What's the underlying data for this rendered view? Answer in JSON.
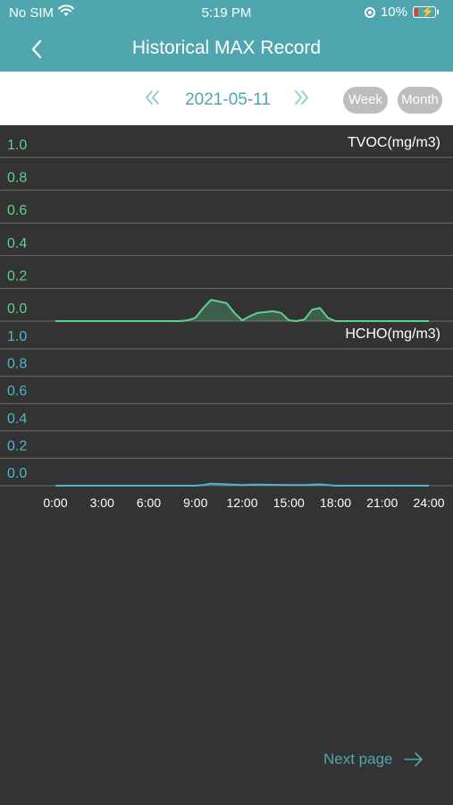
{
  "status_bar": {
    "carrier": "No SIM",
    "time": "5:19 PM",
    "battery": "10%"
  },
  "header": {
    "title": "Historical MAX Record"
  },
  "date_bar": {
    "date": "2021-05-11",
    "week_label": "Week",
    "month_label": "Month"
  },
  "colors": {
    "teal": "#4fa6ae",
    "tvoc_green": "#5fd08f",
    "hcho_blue": "#4ab7c8",
    "background": "#333333"
  },
  "chart_data": [
    {
      "type": "area",
      "title": "TVOC(mg/m3)",
      "xlabel": "",
      "ylabel": "",
      "ylim": [
        0,
        1.0
      ],
      "y_ticks": [
        "1.0",
        "0.8",
        "0.6",
        "0.4",
        "0.2",
        "0.0"
      ],
      "x": [
        0,
        3,
        6,
        8,
        8.5,
        9,
        9.5,
        10,
        11,
        11.5,
        12,
        12.5,
        13,
        14,
        14.5,
        15,
        15.5,
        16,
        16.5,
        17,
        17.5,
        18,
        21,
        24
      ],
      "values": [
        0,
        0,
        0,
        0,
        0.005,
        0.02,
        0.08,
        0.13,
        0.11,
        0.05,
        0.005,
        0.03,
        0.05,
        0.06,
        0.05,
        0.005,
        0,
        0.01,
        0.07,
        0.08,
        0.02,
        0,
        0,
        0
      ],
      "series": [
        {
          "name": "TVOC(mg/m3)"
        }
      ],
      "grid": true
    },
    {
      "type": "area",
      "title": "HCHO(mg/m3)",
      "xlabel": "",
      "ylabel": "",
      "ylim": [
        0,
        1.0
      ],
      "y_ticks": [
        "1.0",
        "0.8",
        "0.6",
        "0.4",
        "0.2",
        "0.0"
      ],
      "x_ticks": [
        "0:00",
        "3:00",
        "6:00",
        "9:00",
        "12:00",
        "15:00",
        "18:00",
        "21:00",
        "24:00"
      ],
      "x": [
        0,
        3,
        6,
        9,
        9.5,
        10,
        11,
        12,
        13,
        15,
        16,
        17,
        18,
        21,
        24
      ],
      "values": [
        0,
        0,
        0,
        0,
        0.005,
        0.015,
        0.01,
        0.005,
        0.008,
        0.005,
        0.005,
        0.01,
        0,
        0,
        0
      ],
      "series": [
        {
          "name": "HCHO(mg/m3)"
        }
      ],
      "grid": true
    }
  ],
  "footer": {
    "next_page": "Next page"
  }
}
